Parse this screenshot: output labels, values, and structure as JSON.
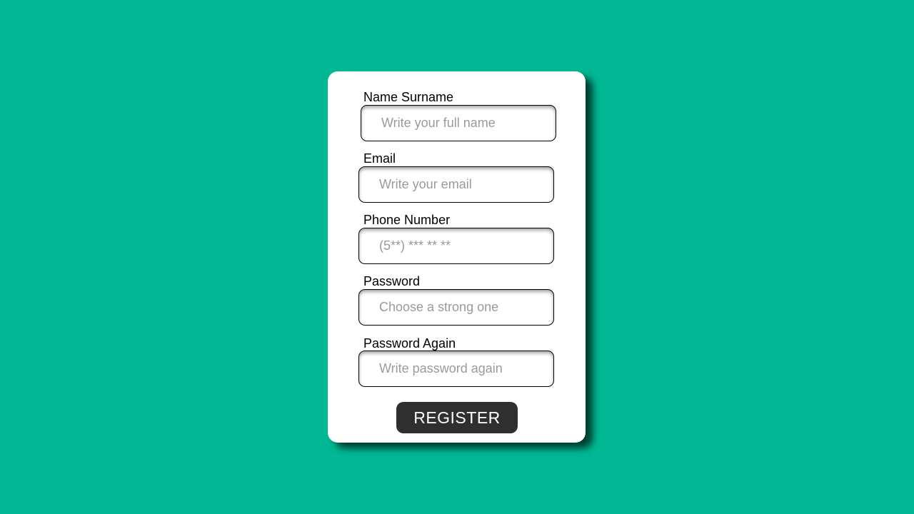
{
  "form": {
    "fields": [
      {
        "label": "Name Surname",
        "placeholder": "Write your full name",
        "value": ""
      },
      {
        "label": "Email",
        "placeholder": "Write your email",
        "value": ""
      },
      {
        "label": "Phone Number",
        "placeholder": "(5**) *** ** **",
        "value": ""
      },
      {
        "label": "Password",
        "placeholder": "Choose a strong one",
        "value": ""
      },
      {
        "label": "Password Again",
        "placeholder": "Write password again",
        "value": ""
      }
    ],
    "register_label": "REGISTER"
  },
  "colors": {
    "background": "#00b894",
    "card": "#ffffff",
    "button": "#2f2f2f",
    "button_text": "#ffffff",
    "placeholder": "#9a9a9a"
  }
}
